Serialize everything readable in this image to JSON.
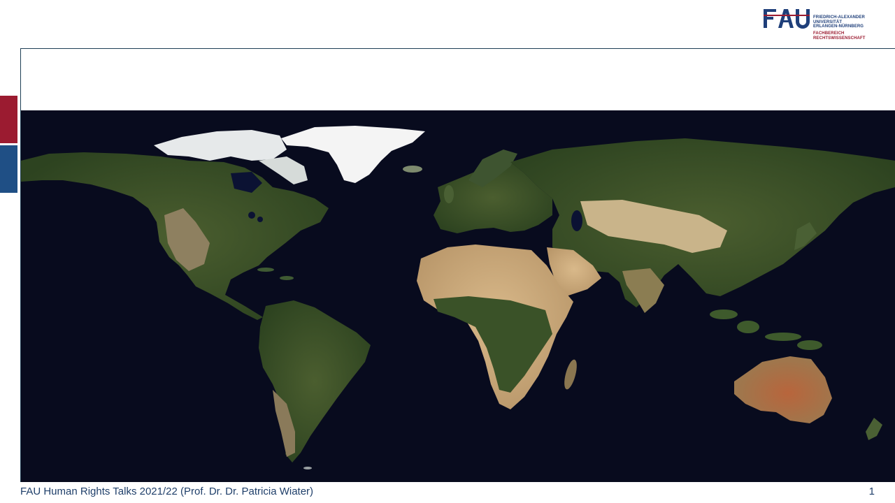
{
  "header": {
    "logo": {
      "mark": "FAU",
      "university_lines": [
        "FRIEDRICH-ALEXANDER",
        "UNIVERSITÄT",
        "ERLANGEN-NÜRNBERG"
      ],
      "faculty_lines": [
        "FACHBEREICH",
        "RECHTSWISSENSCHAFT"
      ],
      "colors": {
        "blue": "#1f3f7a",
        "red": "#9b1b30"
      }
    }
  },
  "sidebar_accents": {
    "top_color": "#9b1b30",
    "bottom_color": "#1f4f85"
  },
  "slide": {
    "title": "",
    "map": {
      "type": "world-satellite-map",
      "ocean_color": "#080b1e"
    }
  },
  "footer": {
    "text": "FAU Human Rights Talks 2021/22 (Prof. Dr. Dr. Patricia Wiater)",
    "page_number": "1"
  }
}
